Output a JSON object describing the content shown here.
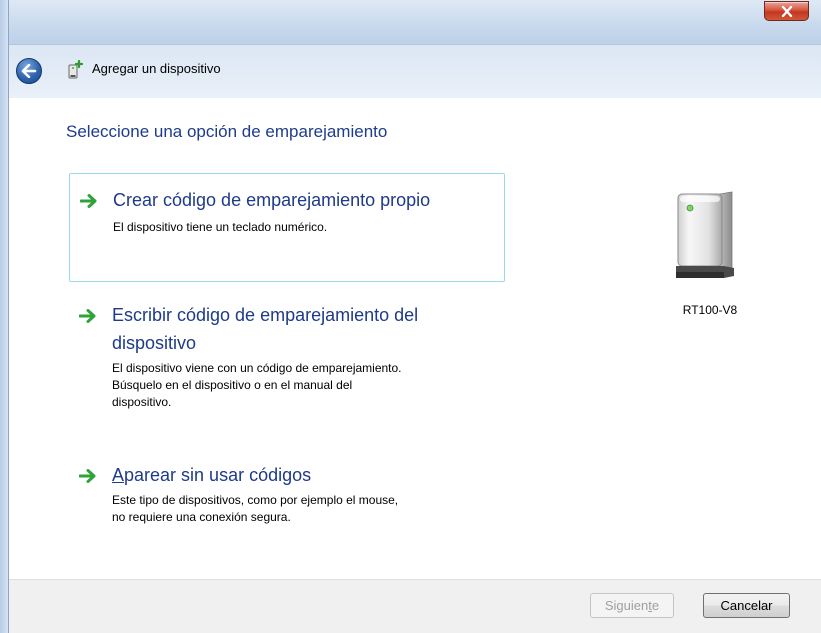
{
  "window": {
    "close_glyph": "x"
  },
  "header": {
    "title": "Agregar un dispositivo",
    "back_icon": "back-arrow-icon",
    "dialog_icon": "add-device-icon"
  },
  "main": {
    "heading": "Seleccione una opción de emparejamiento",
    "options": [
      {
        "title": "Crear código de emparejamiento propio",
        "description": "El dispositivo tiene un teclado numérico.",
        "selected": true
      },
      {
        "title_line1": "Escribir código de emparejamiento del",
        "title_line2": "dispositivo",
        "description_line1": "El dispositivo viene con un código de emparejamiento.",
        "description_line2": "Búsquelo en el dispositivo o en el manual del",
        "description_line3": "dispositivo.",
        "selected": false
      },
      {
        "title": "Aparear sin usar códigos",
        "description_line1": "Este tipo de dispositivos, como por ejemplo el mouse,",
        "description_line2": "no requiere una conexión segura.",
        "selected": false
      }
    ],
    "device": {
      "name": "RT100-V8",
      "icon": "speaker-device-icon"
    }
  },
  "footer": {
    "next_label_pre": "Siguien",
    "next_label_mnemonic": "t",
    "next_label_post": "e",
    "next_enabled": false,
    "cancel_label": "Cancelar"
  },
  "colors": {
    "heading": "#1e3c8c",
    "arrow": "#2fa33a",
    "selected_border": "#99d8ee",
    "close_button": "#c8452c"
  }
}
